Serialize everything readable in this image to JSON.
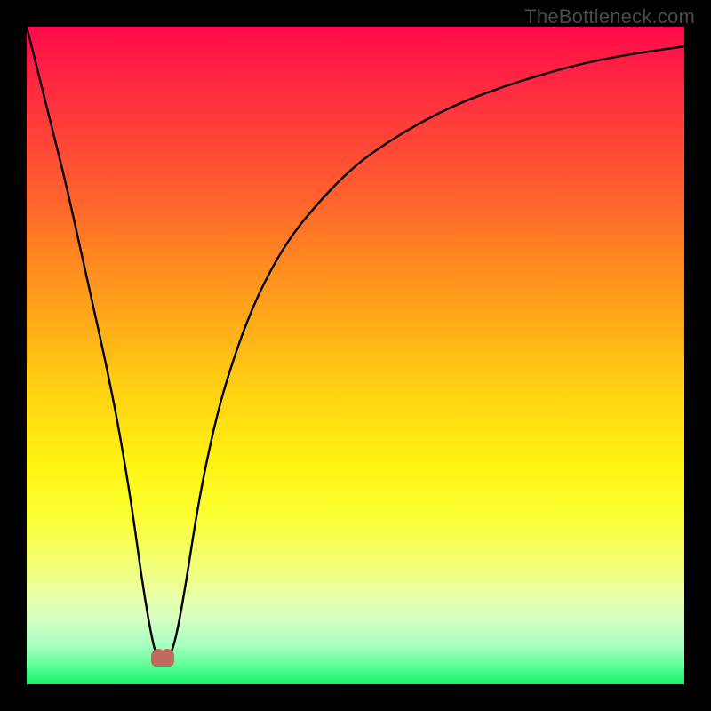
{
  "watermark": "TheBottleneck.com",
  "chart_data": {
    "type": "line",
    "title": "",
    "xlabel": "",
    "ylabel": "",
    "xlim": [
      0,
      100
    ],
    "ylim": [
      0,
      100
    ],
    "grid": false,
    "legend": false,
    "series": [
      {
        "name": "curve",
        "x": [
          0,
          2,
          4,
          6,
          8,
          10,
          12,
          14,
          16,
          17.5,
          19,
          20,
          21.3,
          22.5,
          24,
          26,
          28,
          30,
          33,
          36,
          40,
          45,
          50,
          55,
          60,
          65,
          70,
          75,
          80,
          85,
          90,
          95,
          100
        ],
        "y": [
          100,
          92,
          84,
          76,
          67,
          58,
          49,
          39,
          27,
          16,
          7,
          3.5,
          3.5,
          6,
          14,
          27,
          37,
          45,
          54,
          61,
          68,
          74,
          79,
          82.5,
          85.5,
          88,
          90,
          91.7,
          93.2,
          94.5,
          95.5,
          96.3,
          97
        ]
      }
    ],
    "minimum_markers": [
      {
        "x": 20,
        "y": 3.5
      },
      {
        "x": 21.3,
        "y": 3.5
      }
    ],
    "colors": {
      "curve": "#000000",
      "marker": "#c16a5f",
      "gradient_top": "#ff0a4a",
      "gradient_bottom": "#18f268"
    }
  }
}
